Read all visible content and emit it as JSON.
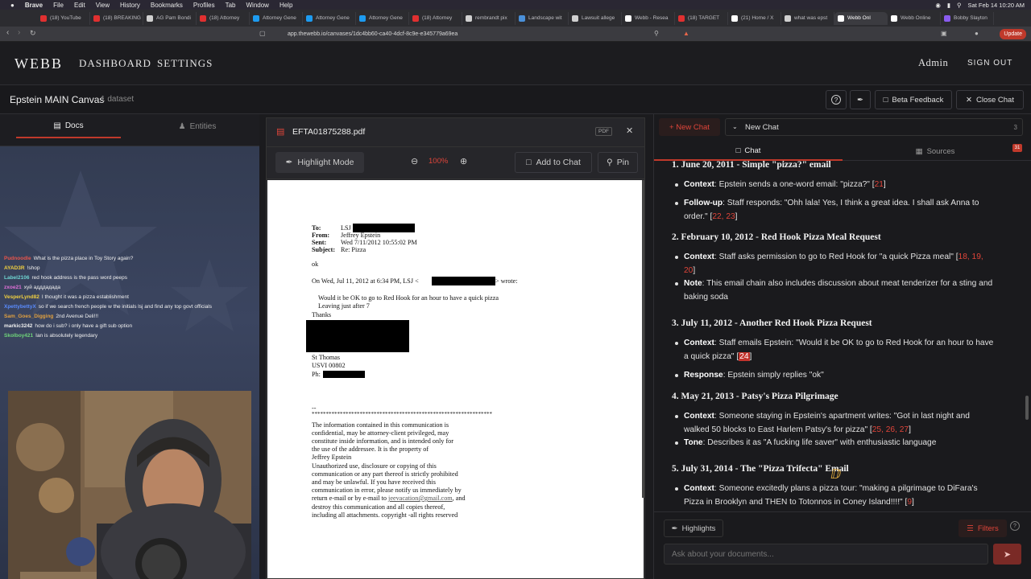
{
  "os": {
    "app": "Brave",
    "menu": [
      "File",
      "Edit",
      "View",
      "History",
      "Bookmarks",
      "Profiles",
      "Tab",
      "Window",
      "Help"
    ],
    "clock": "Sat Feb 14  10:20 AM"
  },
  "browser": {
    "tabs": [
      "(18) YouTube",
      "(18) BREAKING",
      "AG Pam Bondi",
      "(18) Attorney",
      "Attorney Gene",
      "Attorney Gene",
      "Attorney Gene",
      "(18) Attorney",
      "rembrandt pix",
      "Landscape wit",
      "Lawsuit allege",
      "Webb - Resea",
      "(18) TARGET",
      "(21) Home / X",
      "what was epst",
      "Webb Onl",
      "Webb Online",
      "Bobby Slayton"
    ],
    "active_tab_index": 15,
    "url": "app.thewebb.io/canvases/1dc4bb60-ca40-4dcf-8c9e-e345779a69ea",
    "update_label": "Update"
  },
  "app": {
    "logo": "WEBB",
    "nav": [
      "DASHBOARD",
      "SETTINGS"
    ],
    "admin": "Admin",
    "signout": "SIGN OUT"
  },
  "canvas": {
    "title": "Epstein MAIN Canvas",
    "datasets": "1 dataset",
    "beta": "Beta Feedback",
    "close_chat": "Close Chat"
  },
  "left": {
    "tab_docs": "Docs",
    "tab_entities": "Entities"
  },
  "stream_chat": [
    {
      "user": "Pudnoodle",
      "color": "#e8554b",
      "msg": "What is the pizza place in Toy Story again?"
    },
    {
      "user": "AYAD3R",
      "color": "#f0d040",
      "msg": "!shop"
    },
    {
      "user": "Label2106",
      "color": "#6fd4d0",
      "msg": "red hook address is the pass word peeps"
    },
    {
      "user": "zxoe21",
      "color": "#e070d8",
      "msg": "хуй адддадада"
    },
    {
      "user": "VesperLynd82",
      "color": "#f0d040",
      "msg": "I thought it was a pizza establishment"
    },
    {
      "user": "XpettybettyX",
      "color": "#5a8cff",
      "msg": "so if we search french people w the initials lsj and find any top govt officials"
    },
    {
      "user": "Sam_Goes_Digging",
      "color": "#e0a040",
      "msg": "2nd Avenue Deli!!!"
    },
    {
      "user": "markic3242",
      "color": "#f0f0f0",
      "msg": "how do i sub? i only have a gift sub option"
    },
    {
      "user": "Skolboy421",
      "color": "#6fd47a",
      "msg": "Ian is absolutely legendary"
    }
  ],
  "pdf": {
    "filename": "EFTA01875288.pdf",
    "badge": "PDF",
    "highlight": "Highlight Mode",
    "zoom": "100%",
    "add_to_chat": "Add to Chat",
    "pin": "Pin",
    "lines": {
      "to_k": "To:",
      "to_v": "LSJ",
      "from_k": "From:",
      "from_v": "Jeffrey Epstein",
      "sent_k": "Sent:",
      "sent_v": "Wed 7/11/2012 10:55:02 PM",
      "subj_k": "Subject:",
      "subj_v": "Re: Pizza",
      "ok": "ok",
      "quote_a": "On Wed, Jul 11, 2012 at 6:34 PM, LSJ <",
      "quote_b": "> wrote:",
      "q1": "Would it be OK to go to Red Hook for an hour to have a quick pizza",
      "q2": "Leaving just after 7",
      "q3": "Thanks",
      "s1": "St Thomas",
      "s2": "USVI 00802",
      "s3": "Ph:",
      "dash": "--",
      "stars": "****************************************************************",
      "d1": "The information contained in this communication is",
      "d2": "confidential, may be attorney-client privileged, may",
      "d3": "constitute inside information, and is intended only for",
      "d4": "the use of the addressee. It is the property of",
      "d5": "Jeffrey Epstein",
      "d6": "Unauthorized use, disclosure or copying of this",
      "d7": "communication or any part thereof is strictly prohibited",
      "d8": "and may be unlawful. If you have received this",
      "d9": "communication in error, please notify us immediately by",
      "d10a": "return e-mail or by e-mail to ",
      "d10b": "jeevacation@gmail.com",
      "d10c": ", and",
      "d11": "destroy this communication and all copies thereof,",
      "d12": "including all attachments. copyright -all rights reserved"
    }
  },
  "chat": {
    "new_chat_btn": "+ New Chat",
    "session": "New Chat",
    "session_count": "3",
    "tab_chat": "Chat",
    "tab_sources": "Sources",
    "sources_badge": "31",
    "highlights": "Highlights",
    "filters": "Filters",
    "placeholder": "Ask about your documents...",
    "items": [
      {
        "h": "1. June 20, 2011 - Simple \"pizza?\" email"
      },
      {
        "k": "Context",
        "t": ": Epstein sends a one-word email: \"pizza?\" [",
        "refs": "21",
        "end": "]"
      },
      {
        "k": "Follow-up",
        "t": ": Staff responds: \"Ohh lala! Yes, I think a great idea. I shall ask Anna to order.\" [",
        "refs": "22, 23",
        "end": "]"
      },
      {
        "h": "2. February 10, 2012 - Red Hook Pizza Meal Request"
      },
      {
        "k": "Context",
        "t": ": Staff asks permission to go to Red Hook for \"a quick Pizza meal\" [",
        "refs": "18, 19, 20",
        "end": "]"
      },
      {
        "k": "Note",
        "t": ": This email chain also includes discussion about meat tenderizer for a sting and baking soda",
        "refs": "",
        "end": ""
      },
      {
        "h": "3. July 11, 2012 - Another Red Hook Pizza Request"
      },
      {
        "k": "Context",
        "t": ": Staff emails Epstein: \"Would it be OK to go to Red Hook for an hour to have a quick pizza\" [",
        "refs": "24",
        "end": "]"
      },
      {
        "k": "Response",
        "t": ": Epstein simply replies \"ok\"",
        "refs": "",
        "end": ""
      },
      {
        "h": "4. May 21, 2013 - Patsy's Pizza Pilgrimage"
      },
      {
        "k": "Context",
        "t": ": Someone staying in Epstein's apartment writes: \"Got in last night and walked 50 blocks to East Harlem Patsy's for pizza\" [",
        "refs": "25, 26, 27",
        "end": "]"
      },
      {
        "k": "Tone",
        "t": ": Describes it as \"A fucking life saver\" with enthusiastic language",
        "refs": "",
        "end": ""
      },
      {
        "h": "5. July 31, 2014 - The \"Pizza Trifecta\" Email"
      },
      {
        "k": "Context",
        "t": ": Someone excitedly plans a pizza tour: \"making a pilgrimage to DiFara's Pizza in Brooklyn and THEN to Totonnos in Coney Island!!!!\" [",
        "refs": "9",
        "end": "]"
      }
    ]
  }
}
